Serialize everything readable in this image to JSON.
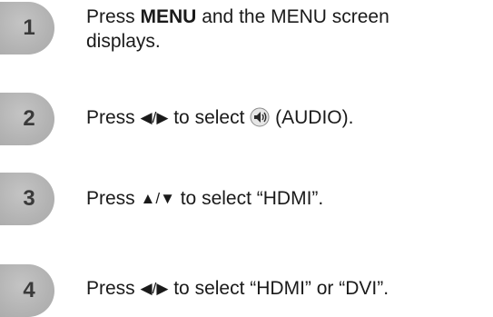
{
  "steps": [
    {
      "number": "1",
      "line1_prefix": "Press ",
      "line1_bold": "MENU",
      "line1_suffix": " and the MENU screen",
      "line2": "displays."
    },
    {
      "number": "2",
      "prefix": "Press ",
      "arrows": "◀/▶",
      "middle": " to select ",
      "icon": "audio-icon",
      "suffix": " (AUDIO)."
    },
    {
      "number": "3",
      "prefix": "Press ",
      "arrows": "▲/▼",
      "suffix": " to select “HDMI”."
    },
    {
      "number": "4",
      "prefix": "Press ",
      "arrows": "◀/▶",
      "suffix": " to select “HDMI” or “DVI”."
    }
  ]
}
